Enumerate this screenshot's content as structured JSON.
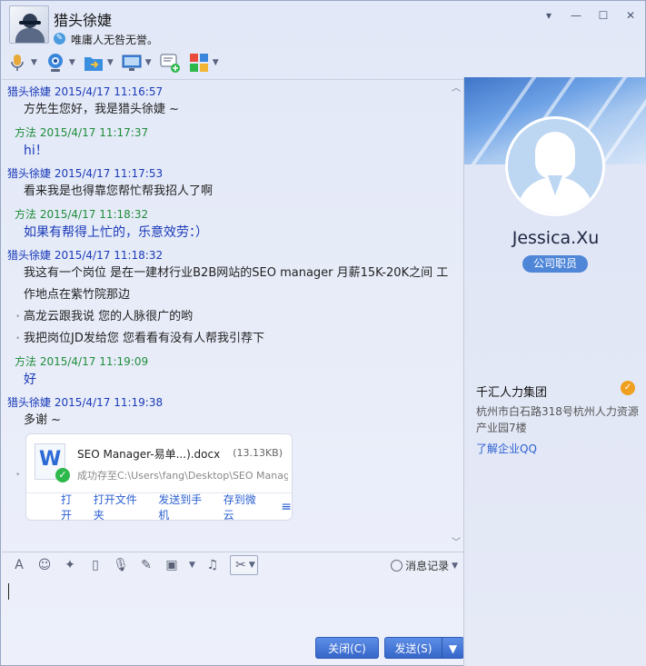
{
  "header": {
    "title": "猎头徐婕",
    "signature": "唯庸人无咎无誉。"
  },
  "toolbar": {
    "items": [
      "voice-icon",
      "video-icon",
      "file-transfer-icon",
      "remote-desktop-icon",
      "create-discussion-icon",
      "app-grid-icon"
    ]
  },
  "messages": [
    {
      "sender": "猎头徐婕",
      "time": "2015/4/17 11:16:57",
      "side": "them",
      "lines": [
        "方先生您好，我是猎头徐婕 ~"
      ]
    },
    {
      "sender": "方法",
      "time": "2015/4/17 11:17:37",
      "side": "me",
      "lines": [
        "hi！"
      ]
    },
    {
      "sender": "猎头徐婕",
      "time": "2015/4/17 11:17:53",
      "side": "them",
      "lines": [
        "看来我是也得靠您帮忙帮我招人了啊"
      ]
    },
    {
      "sender": "方法",
      "time": "2015/4/17 11:18:32",
      "side": "me",
      "lines": [
        "如果有帮得上忙的，乐意效劳：）"
      ]
    },
    {
      "sender": "猎头徐婕",
      "time": "2015/4/17 11:18:32",
      "side": "them",
      "lines": [
        "我这有一个岗位 是在一建材行业B2B网站的SEO manager 月薪15K-20K之间 工作地点在紫竹院那边"
      ],
      "extra": [
        "高龙云跟我说 您的人脉很广的哟",
        "我把岗位JD发给您 您看看有没有人帮我引荐下"
      ]
    },
    {
      "sender": "方法",
      "time": "2015/4/17 11:19:09",
      "side": "me",
      "lines": [
        "好"
      ]
    },
    {
      "sender": "猎头徐婕",
      "time": "2015/4/17 11:19:38",
      "side": "them",
      "lines": [
        "多谢 ~"
      ]
    }
  ],
  "file": {
    "name": "SEO Manager-易单...).docx",
    "size": "(13.13KB)",
    "status": "成功存至C:\\Users\\fang\\Desktop\\SEO Manag...",
    "actions": [
      "打开",
      "打开文件夹",
      "发送到手机",
      "存到微云"
    ]
  },
  "input_toolbar": {
    "history_label": "消息记录"
  },
  "buttons": {
    "close": "关闭(C)",
    "send": "发送(S)"
  },
  "profile": {
    "name": "Jessica.Xu",
    "role": "公司职员",
    "company": "千汇人力集团",
    "address": "杭州市白石路318号杭州人力资源产业园7楼",
    "link": "了解企业QQ"
  }
}
